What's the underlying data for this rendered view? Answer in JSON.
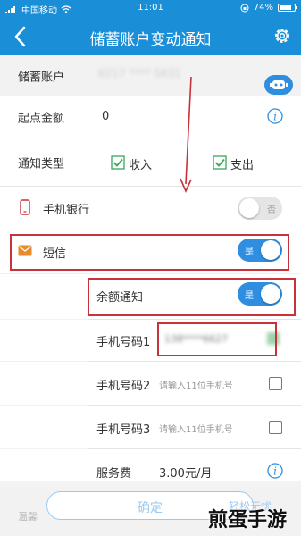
{
  "status_bar": {
    "carrier": "中国移动",
    "time": "11:01",
    "battery": "74%"
  },
  "nav": {
    "title": "储蓄账户变动通知"
  },
  "account": {
    "label": "储蓄账户",
    "value": "6217 **** 5831"
  },
  "start_amount": {
    "label": "起点金额",
    "value": "0"
  },
  "notify_type": {
    "label": "通知类型",
    "income": "收入",
    "expense": "支出"
  },
  "mobile_banking": {
    "label": "手机银行",
    "toggle_text": "否"
  },
  "sms": {
    "label": "短信",
    "toggle_text": "是"
  },
  "balance_notify": {
    "label": "余额通知",
    "toggle_text": "是"
  },
  "phone1": {
    "label": "手机号码1",
    "value": "138****6627"
  },
  "phone2": {
    "label": "手机号码2",
    "placeholder": "请输入11位手机号"
  },
  "phone3": {
    "label": "手机号码3",
    "placeholder": "请输入11位手机号"
  },
  "fee": {
    "label": "服务费",
    "value": "3.00元/月"
  },
  "footer": {
    "confirm": "确定",
    "left_text": "温馨",
    "right_text": "轻松无忧"
  },
  "watermark": "煎蛋手游",
  "colors": {
    "primary": "#1a8fd8",
    "accent_red": "#c8323a",
    "check_green": "#3aa65a"
  }
}
